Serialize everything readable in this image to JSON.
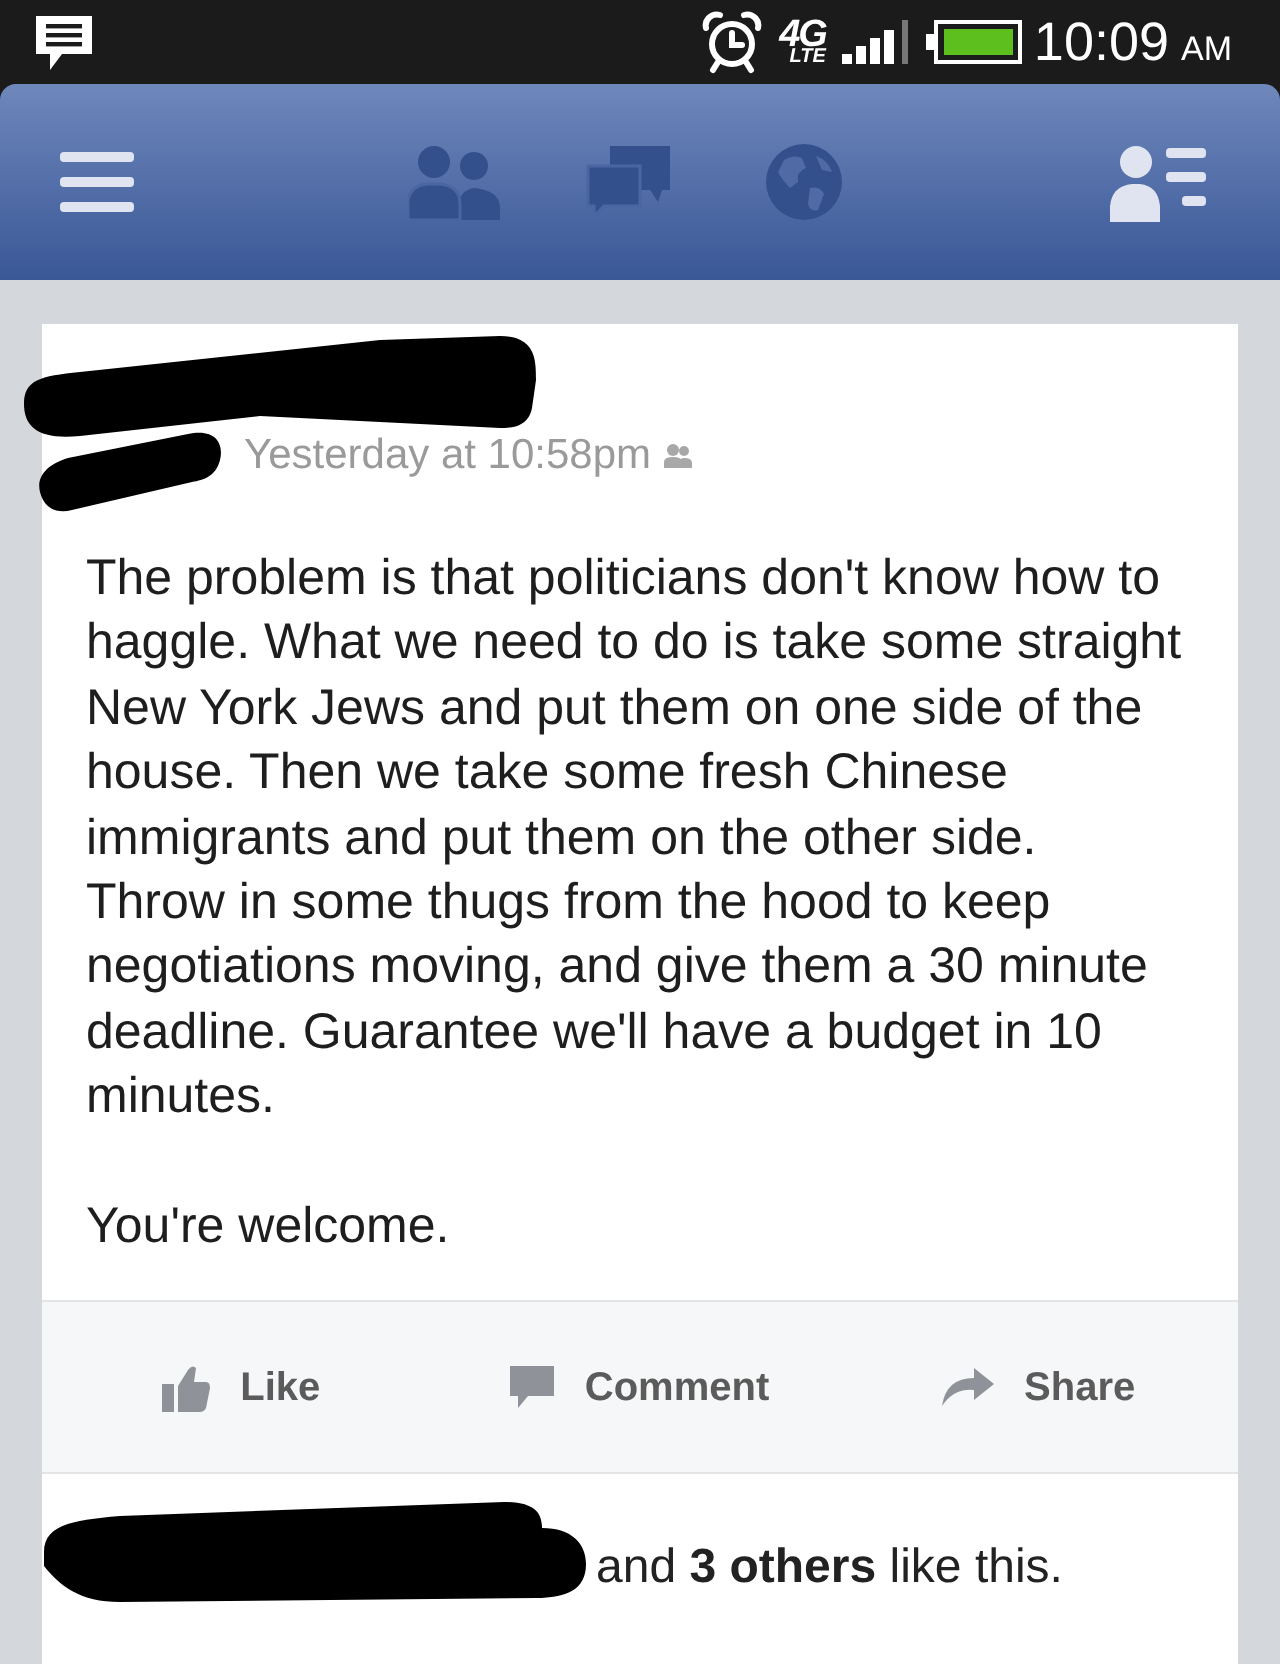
{
  "status_bar": {
    "network": "4G",
    "network_sub": "LTE",
    "time": "10:09",
    "meridiem": "AM"
  },
  "post": {
    "timestamp": "Yesterday at 10:58pm",
    "paragraphs": [
      "The problem is that politicians don't know how to haggle. What we need to do is take some straight New York Jews and put them on one side of the house. Then we take some fresh Chinese immigrants and put them on the other side. Throw in some thugs from the hood to keep negotiations moving, and give them a 30 minute deadline. Guarantee we'll have a budget in 10 minutes.",
      "You're welcome."
    ],
    "actions": [
      {
        "kind": "like",
        "label": "Like"
      },
      {
        "kind": "comment",
        "label": "Comment"
      },
      {
        "kind": "share",
        "label": "Share"
      }
    ],
    "likes": "and **3 others** like this."
  }
}
